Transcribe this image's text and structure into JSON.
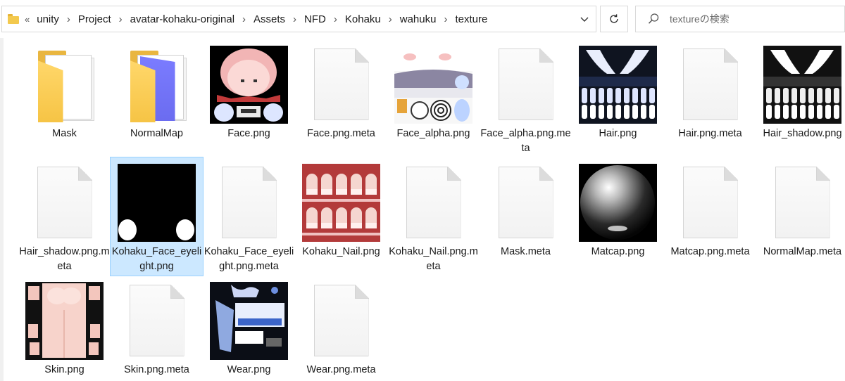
{
  "breadcrumb": {
    "lead": "«",
    "items": [
      "unity",
      "Project",
      "avatar-kohaku-original",
      "Assets",
      "NFD",
      "Kohaku",
      "wahuku",
      "texture"
    ]
  },
  "search": {
    "placeholder": "textureの検索"
  },
  "icons": {
    "folder": "folder-icon",
    "dropdown": "chevron-down-icon",
    "refresh": "refresh-icon",
    "search": "search-icon"
  },
  "files": [
    {
      "name": "Mask",
      "kind": "folder"
    },
    {
      "name": "NormalMap",
      "kind": "folder-blue"
    },
    {
      "name": "Face.png",
      "kind": "face"
    },
    {
      "name": "Face.png.meta",
      "kind": "file"
    },
    {
      "name": "Face_alpha.png",
      "kind": "face-alpha"
    },
    {
      "name": "Face_alpha.png.meta",
      "kind": "file"
    },
    {
      "name": "Hair.png",
      "kind": "hair"
    },
    {
      "name": "Hair.png.meta",
      "kind": "file"
    },
    {
      "name": "Hair_shadow.png",
      "kind": "hair-shadow"
    },
    {
      "name": "Hair_shadow.png.meta",
      "kind": "file"
    },
    {
      "name": "Kohaku_Face_eyelight.png",
      "kind": "eyelight",
      "selected": true
    },
    {
      "name": "Kohaku_Face_eyelight.png.meta",
      "kind": "file"
    },
    {
      "name": "Kohaku_Nail.png",
      "kind": "nail"
    },
    {
      "name": "Kohaku_Nail.png.meta",
      "kind": "file"
    },
    {
      "name": "Mask.meta",
      "kind": "file"
    },
    {
      "name": "Matcap.png",
      "kind": "matcap"
    },
    {
      "name": "Matcap.png.meta",
      "kind": "file"
    },
    {
      "name": "NormalMap.meta",
      "kind": "file"
    },
    {
      "name": "Skin.png",
      "kind": "skin"
    },
    {
      "name": "Skin.png.meta",
      "kind": "file"
    },
    {
      "name": "Wear.png",
      "kind": "wear"
    },
    {
      "name": "Wear.png.meta",
      "kind": "file"
    }
  ]
}
